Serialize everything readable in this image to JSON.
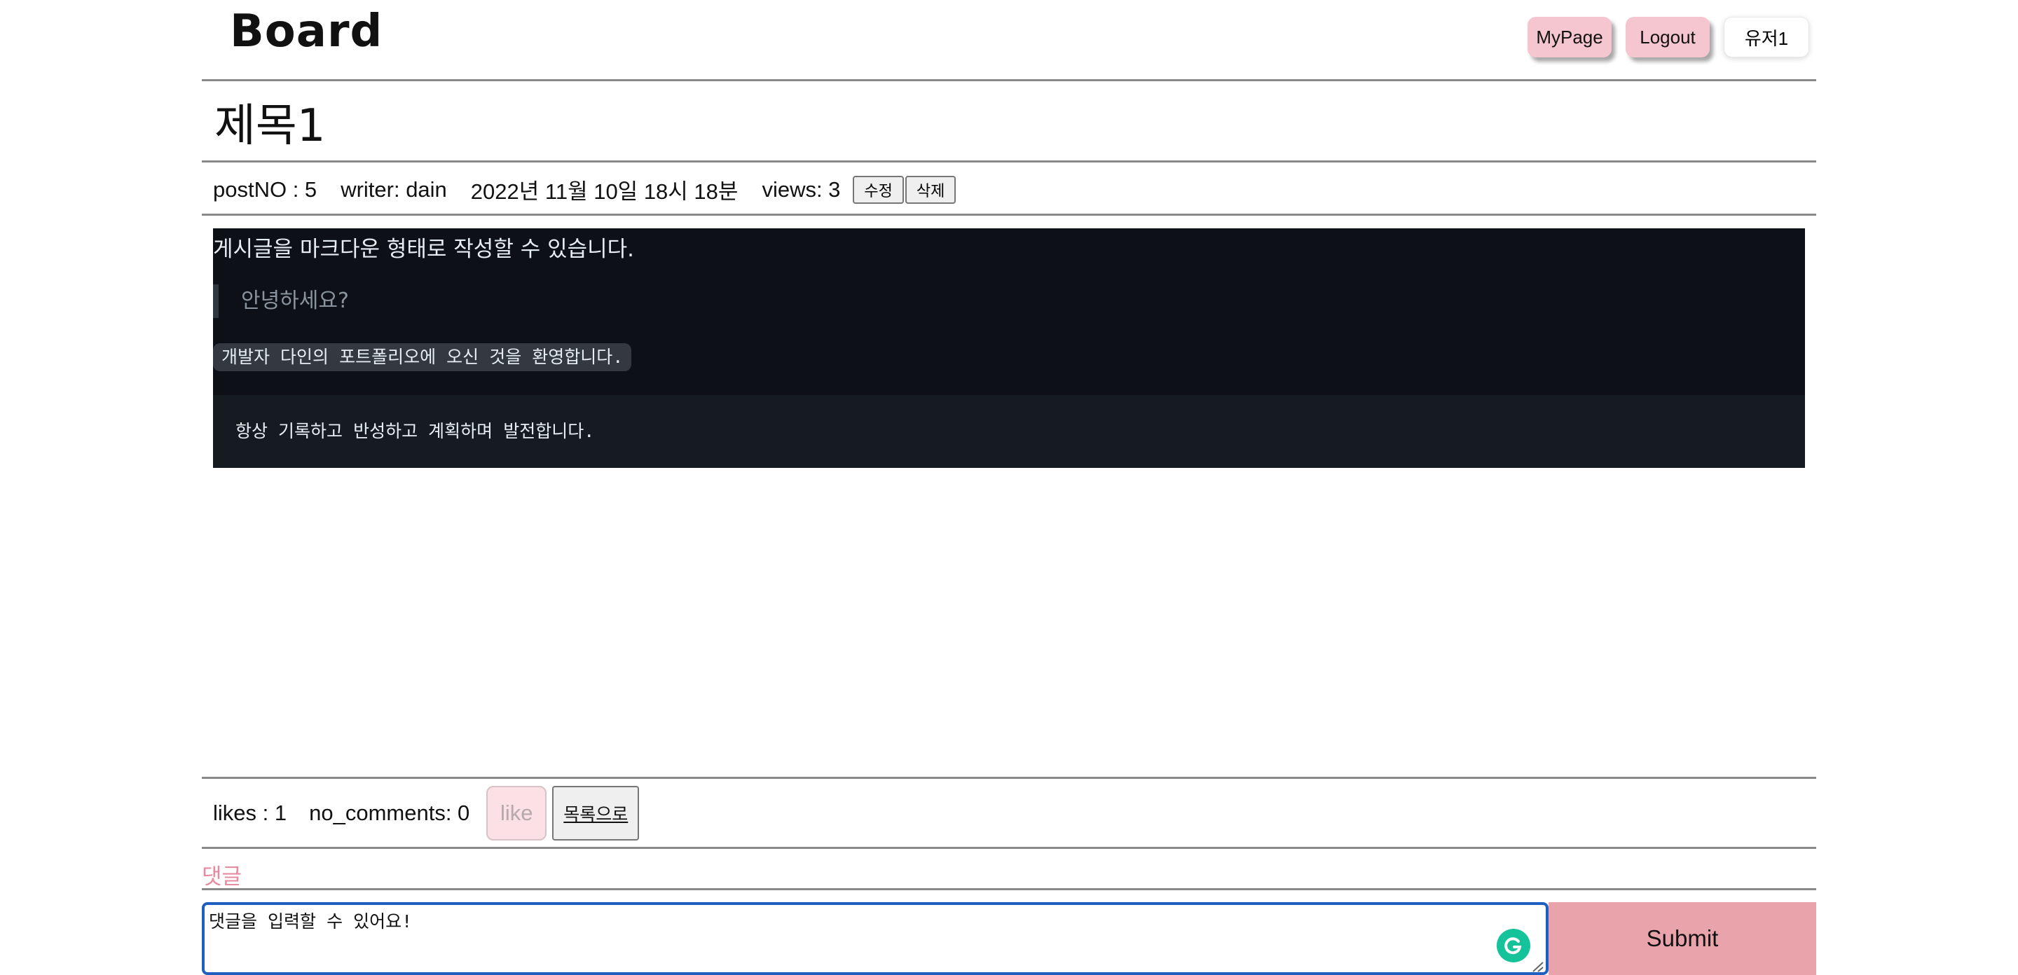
{
  "header": {
    "brand": "Board",
    "nav": {
      "mypage_label": "MyPage",
      "logout_label": "Logout",
      "user_label": "유저1"
    }
  },
  "post": {
    "title": "제목1",
    "meta": {
      "post_no": "postNO : 5",
      "writer": "writer: dain",
      "date": "2022년 11월 10일 18시 18분",
      "views": "views: 3",
      "edit_label": "수정",
      "delete_label": "삭제"
    },
    "content": {
      "lead": "게시글을 마크다운 형태로 작성할 수 있습니다.",
      "quote": "안녕하세요?",
      "inline_code": "개발자 다인의 포트폴리오에 오신 것을 환영합니다.",
      "code_block": "항상 기록하고 반성하고 계획하며 발전합니다."
    }
  },
  "stats": {
    "likes": "likes : 1",
    "comments": "no_comments: 0",
    "like_label": "like",
    "list_label": "목록으로"
  },
  "comments": {
    "section_label": "댓글",
    "input_value": "댓글을 입력할 수 있어요!",
    "submit_label": "Submit"
  },
  "colors": {
    "nav_button": "#f5c6cf",
    "content_bg": "#0d1117",
    "submit_bg": "#e8a3ab",
    "comment_label": "#e88aa0",
    "input_focus": "#1f5fbf",
    "grammarly": "#15c39a"
  }
}
